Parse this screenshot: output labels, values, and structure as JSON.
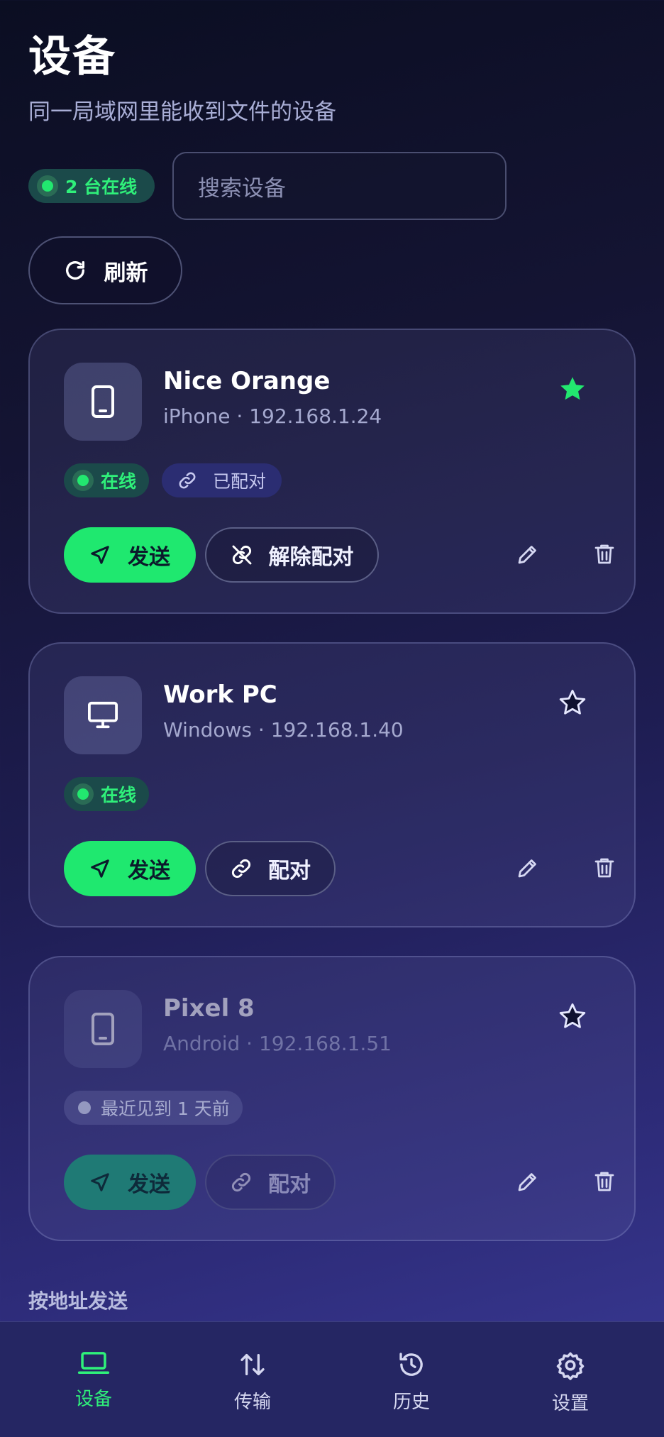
{
  "header": {
    "title": "设备",
    "subtitle": "同一局域网里能收到文件的设备"
  },
  "toolbar": {
    "online_count": "2 台在线",
    "search_placeholder": "搜索设备",
    "refresh_label": "刷新"
  },
  "devices": [
    {
      "name": "Nice Orange",
      "meta": "iPhone · 192.168.1.24",
      "type_icon": "phone-icon",
      "favorite": true,
      "status": "在线",
      "paired_label": "已配对",
      "send_label": "发送",
      "pair_action_label": "解除配对"
    },
    {
      "name": "Work PC",
      "meta": "Windows · 192.168.1.40",
      "type_icon": "monitor-icon",
      "favorite": false,
      "status": "在线",
      "send_label": "发送",
      "pair_action_label": "配对"
    },
    {
      "name": "Pixel 8",
      "meta": "Android · 192.168.1.51",
      "type_icon": "phone-icon",
      "favorite": false,
      "status": "最近见到 1 天前",
      "send_label": "发送",
      "pair_action_label": "配对"
    }
  ],
  "section": {
    "send_by_address": "按地址发送"
  },
  "nav": {
    "items": [
      {
        "label": "设备",
        "icon": "laptop-icon",
        "active": true
      },
      {
        "label": "传输",
        "icon": "transfer-icon",
        "active": false
      },
      {
        "label": "历史",
        "icon": "history-icon",
        "active": false
      },
      {
        "label": "设置",
        "icon": "settings-icon",
        "active": false
      }
    ]
  },
  "colors": {
    "accent": "#1fe86f",
    "online_text": "#2ff07a",
    "favorite": "#22e86f",
    "background_top": "#0b0e22",
    "background_bottom": "#3a3a96"
  }
}
